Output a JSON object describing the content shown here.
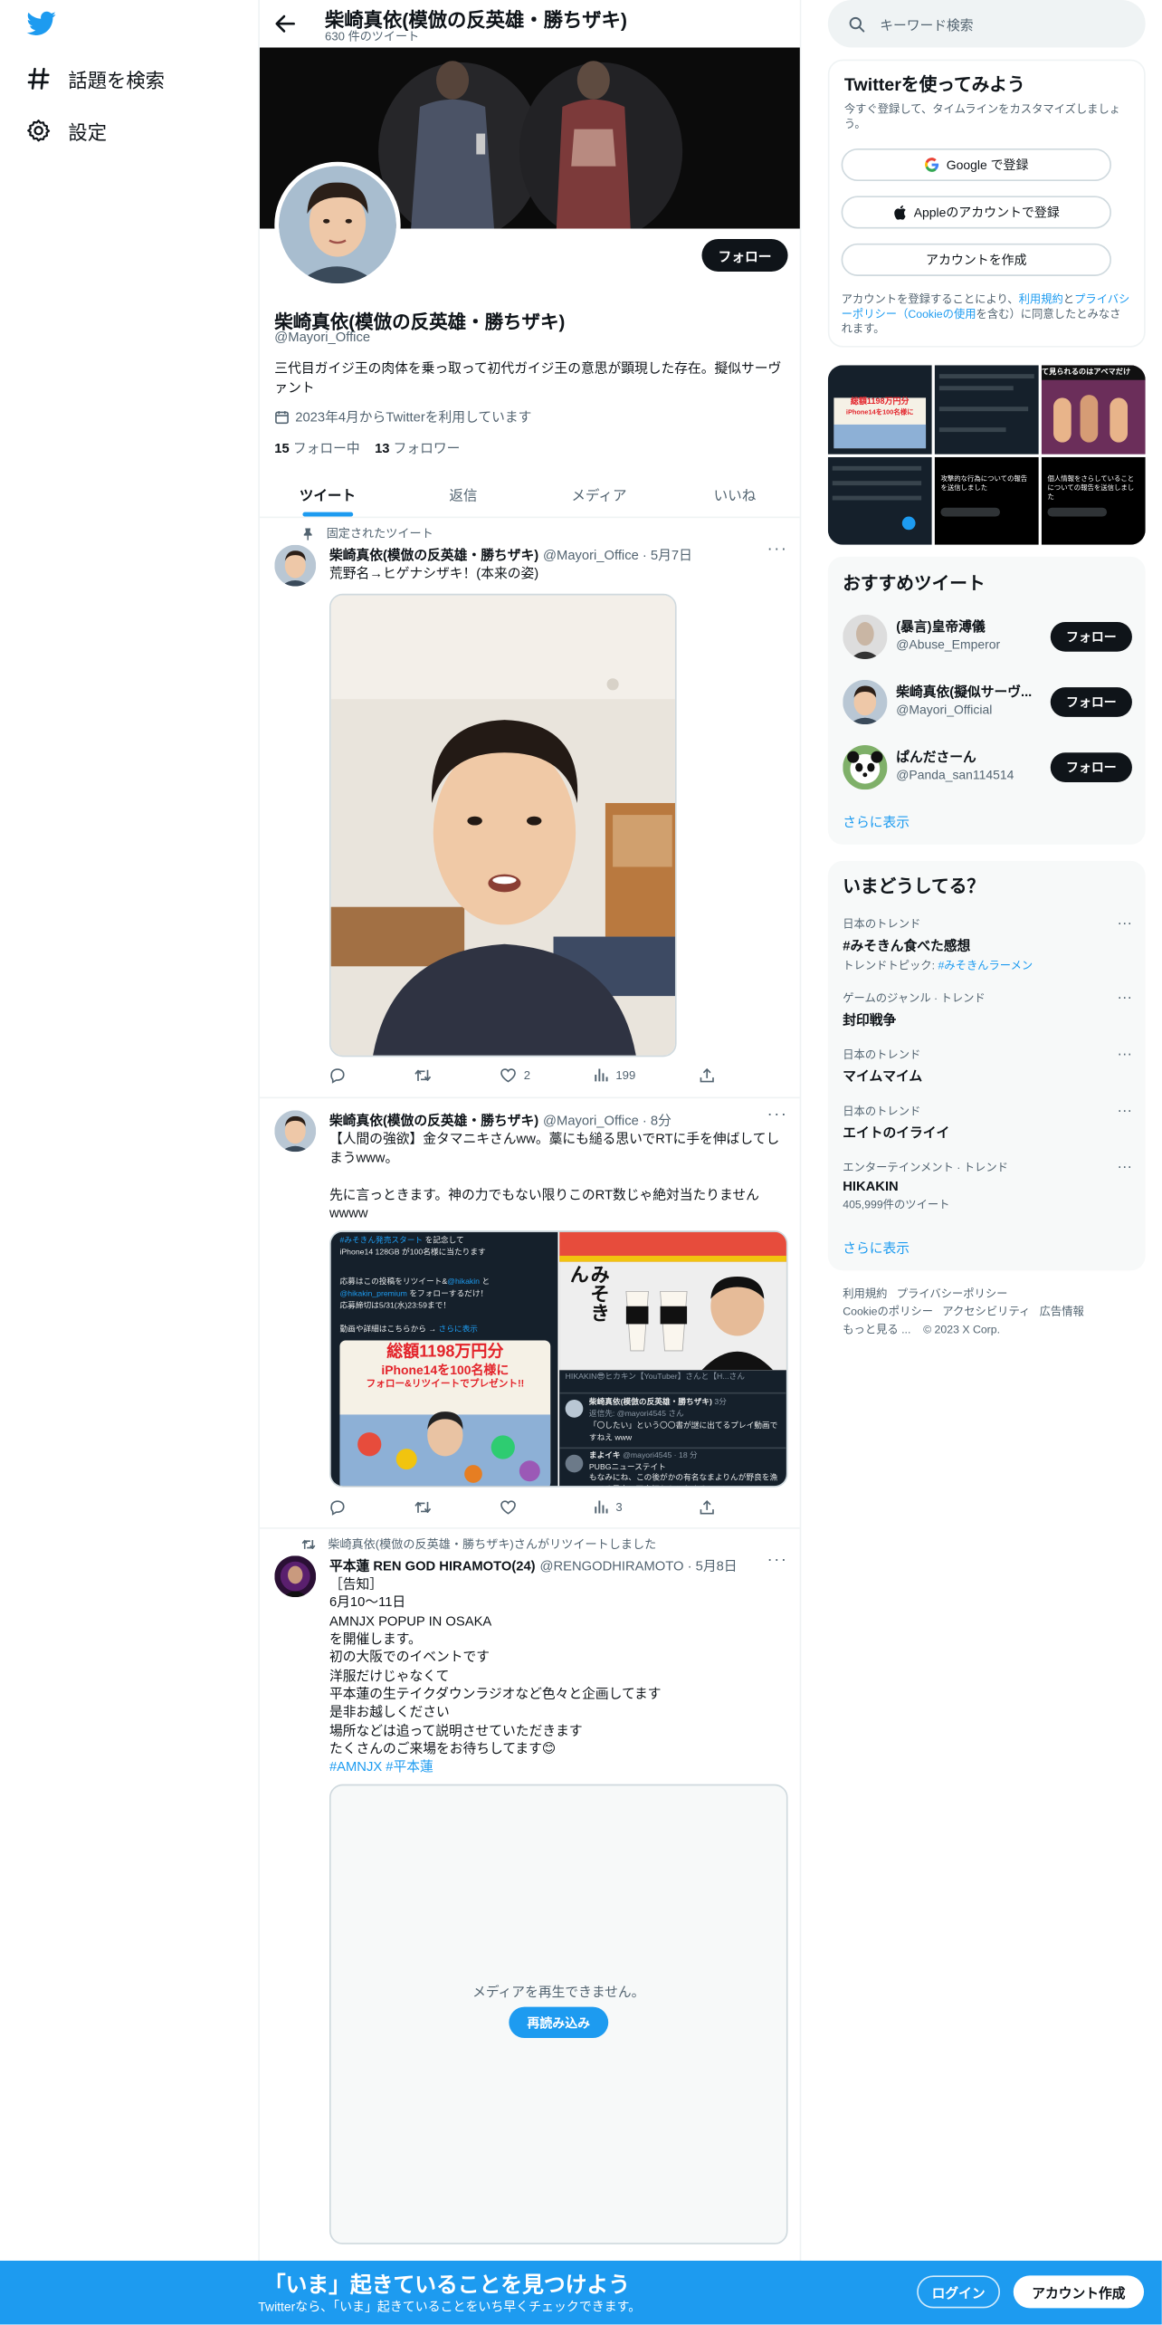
{
  "nav": {
    "explore_label": "話題を検索",
    "settings_label": "設定"
  },
  "topbar": {
    "title": "柴崎真依(模倣の反英雄・勝ちザキ)",
    "tweet_count": "630 件のツイート"
  },
  "profile": {
    "name": "柴崎真依(模倣の反英雄・勝ちザキ)",
    "handle": "@Mayori_Office",
    "bio": "三代目ガイジ王の肉体を乗っ取って初代ガイジ王の意思が顕現した存在。擬似サーヴァント",
    "joined": "2023年4月からTwitterを利用しています",
    "following_count": "15",
    "following_label": "フォロー中",
    "followers_count": "13",
    "followers_label": "フォロワー",
    "follow_label": "フォロー"
  },
  "tabs": [
    "ツイート",
    "返信",
    "メディア",
    "いいね"
  ],
  "tweets": [
    {
      "social": "固定されたツイート",
      "name": "柴崎真依(模倣の反英雄・勝ちザキ)",
      "handle": "@Mayori_Office",
      "time": "5月7日",
      "text": "荒野名→ヒゲナシザキ！(本来の姿)",
      "likes": "2",
      "views": "199"
    },
    {
      "name": "柴崎真依(模倣の反英雄・勝ちザキ)",
      "handle": "@Mayori_Office",
      "time": "8分",
      "text": "【人間の強欲】金タマニキさんww。藁にも縋る思いでRTに手を伸ばしてしまうwww。\n\n先に言っときます。神の力でもない限りこのRT数じゃ絶対当たりませんwwww",
      "views": "3",
      "img_left": {
        "hashtag": "#みそきん発売スタート",
        "line1": "を記念して",
        "line2": "iPhone14 128GB",
        "line2b": "が100名様に当たります",
        "line3": "応募はこの投稿をリツイート&",
        "mention1": "@hikakin",
        "line3b": "と",
        "mention2": "@hikakin_premium",
        "line4": "をフォローするだけ！",
        "line5": "応募締切は5/31(水)23:59まで！",
        "line6": "動画や詳細はこちらから →",
        "more": "さらに表示",
        "promo1": "総額1198万円分",
        "promo2": "iPhone14を100名様に",
        "promo3": "フォロー&リツイートでプレゼント!!"
      },
      "img_right": {
        "product": "みそきん",
        "author": "HIKAKIN😎ヒカキン【YouTuber】さんと【H...さん",
        "reply_name": "柴崎真依(模倣の反英雄・勝ちザキ)",
        "reply_time": "3分",
        "reply_to": "返信先: @mayori4545 さん",
        "reply_text": "「〇したい」という〇〇書が謎に出てるプレイ動画ですねえ www",
        "name2": "まよイキ",
        "handle2": "@mayori4545 · 18 分",
        "text2a": "PUBGニューステイト",
        "text2b": "もなみにね、この後がかの有名なまよりんが野良を漁ってる最中に不意打ちキルをするシーン"
      }
    },
    {
      "social": "柴崎真依(模倣の反英雄・勝ちザキ)さんがリツイートしました",
      "name": "平本蓮 REN GOD HIRAMOTO(24)",
      "handle": "@RENGODHIRAMOTO",
      "time": "5月8日",
      "text": "［告知］\n6月10〜11日\nAMNJX POPUP IN OSAKA\nを開催します。\n初の大阪でのイベントです\n洋服だけじゃなくて\n平本蓮の生テイクダウンラジオなど色々と企画してます\n是非お越しください\n場所などは追って説明させていただきます\nたくさんのご来場をお待ちしてます😊",
      "hashtags": "#AMNJX #平本蓮",
      "media_error": "メディアを再生できません。",
      "reload_label": "再読み込み"
    }
  ],
  "search": {
    "placeholder": "キーワード検索"
  },
  "signup_card": {
    "title": "Twitterを使ってみよう",
    "subtitle": "今すぐ登録して、タイムラインをカスタマイズしましょう。",
    "google": "Google で登録",
    "apple": "Appleのアカウントで登録",
    "create": "アカウントを作成",
    "terms_pre": "アカウントを登録することにより、",
    "terms_link": "利用規約",
    "terms_and": "と",
    "privacy_link": "プライバシーポリシー（Cookieの使用",
    "terms_post": "を含む）に同意したとみなされます。"
  },
  "media_grid": {
    "t1": "総額1198万円分",
    "t2": "iPhone14を100名様に",
    "t3": "て見られるのはアベマだけ",
    "t4": "攻撃的な行為についての報告を送信しました",
    "t5": "個人情報をさらしていることについての報告を送信しました"
  },
  "recommended": {
    "title": "おすすめツイート",
    "accounts": [
      {
        "name": "(暴言)皇帝溥儀",
        "handle": "@Abuse_Emperor"
      },
      {
        "name": "柴崎真依(擬似サーヴ...",
        "handle": "@Mayori_Official"
      },
      {
        "name": "ぱんださーん",
        "handle": "@Panda_san114514"
      }
    ],
    "follow_label": "フォロー",
    "show_more": "さらに表示"
  },
  "trends": {
    "title": "いまどうしてる？",
    "items": [
      {
        "context": "日本のトレンド",
        "name": "#みそきん食べた感想",
        "sub_pre": "トレンドトピック: ",
        "sub_link": "#みそきんラーメン"
      },
      {
        "context": "ゲームのジャンル · トレンド",
        "name": "封印戦争"
      },
      {
        "context": "日本のトレンド",
        "name": "マイムマイム"
      },
      {
        "context": "日本のトレンド",
        "name": "エイトのイライイ"
      },
      {
        "context": "エンターテインメント · トレンド",
        "name": "HIKAKIN",
        "sub": "405,999件のツイート"
      }
    ],
    "show_more": "さらに表示"
  },
  "footer": {
    "links": [
      "利用規約",
      "プライバシーポリシー",
      "Cookieのポリシー",
      "アクセシビリティ",
      "広告情報",
      "もっと見る ...",
      "© 2023 X Corp."
    ]
  },
  "bottombar": {
    "title": "「いま」起きていることを見つけよう",
    "subtitle": "Twitterなら、「いま」起きていることをいち早くチェックできます。",
    "login": "ログイン",
    "signup": "アカウント作成"
  },
  "colors": {
    "accent": "#1d9bf0",
    "text": "#0f1419",
    "muted": "#536471"
  }
}
